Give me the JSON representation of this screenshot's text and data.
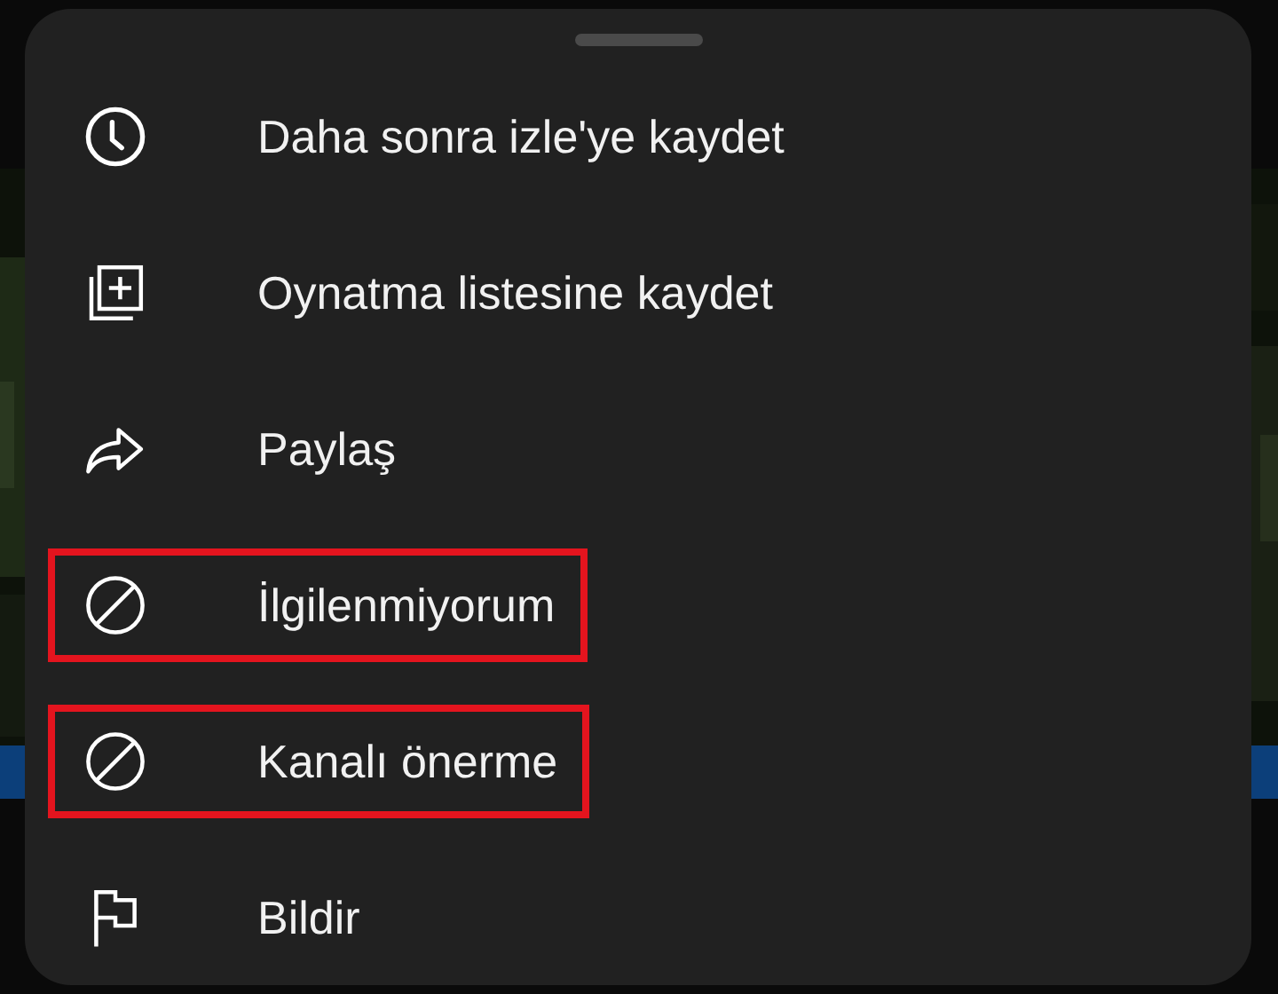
{
  "menu": {
    "items": [
      {
        "kind": "clock",
        "label": "Daha sonra izle'ye kaydet",
        "highlighted": false
      },
      {
        "kind": "playlist",
        "label": "Oynatma listesine kaydet",
        "highlighted": false
      },
      {
        "kind": "share",
        "label": "Paylaş",
        "highlighted": false
      },
      {
        "kind": "block",
        "label": "İlgilenmiyorum",
        "highlighted": true
      },
      {
        "kind": "block",
        "label": "Kanalı önerme",
        "highlighted": true
      },
      {
        "kind": "flag",
        "label": "Bildir",
        "highlighted": false
      }
    ]
  }
}
